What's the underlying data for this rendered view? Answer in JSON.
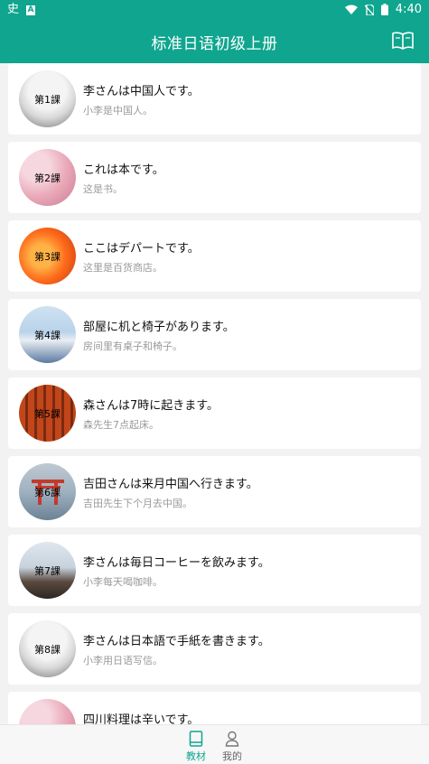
{
  "statusbar": {
    "time": "4:40",
    "left_glyph": "史",
    "left_box": "A"
  },
  "appbar": {
    "title": "标准日语初级上册"
  },
  "lessons": [
    {
      "label": "第1課",
      "jp": "李さんは中国人です。",
      "cn": "小李是中国人。"
    },
    {
      "label": "第2課",
      "jp": "これは本です。",
      "cn": "这是书。"
    },
    {
      "label": "第3課",
      "jp": "ここはデパートです。",
      "cn": "这里是百货商店。"
    },
    {
      "label": "第4課",
      "jp": "部屋に机と椅子があります。",
      "cn": "房间里有桌子和椅子。"
    },
    {
      "label": "第5課",
      "jp": "森さんは7時に起きます。",
      "cn": "森先生7点起床。"
    },
    {
      "label": "第6課",
      "jp": "吉田さんは来月中国へ行きます。",
      "cn": "吉田先生下个月去中国。"
    },
    {
      "label": "第7課",
      "jp": "李さんは毎日コーヒーを飲みます。",
      "cn": "小李每天喝咖啡。"
    },
    {
      "label": "第8課",
      "jp": "李さんは日本語で手紙を書きます。",
      "cn": "小李用日语写信。"
    },
    {
      "label": "",
      "jp": "四川料理は辛いです。",
      "cn": ""
    }
  ],
  "tabs": {
    "textbook": "教材",
    "mine": "我的"
  },
  "colors": {
    "accent": "#0fa58e"
  },
  "icons": {
    "appbar": "book-open-icon",
    "tab_textbook": "book-icon",
    "tab_mine": "person-icon"
  }
}
